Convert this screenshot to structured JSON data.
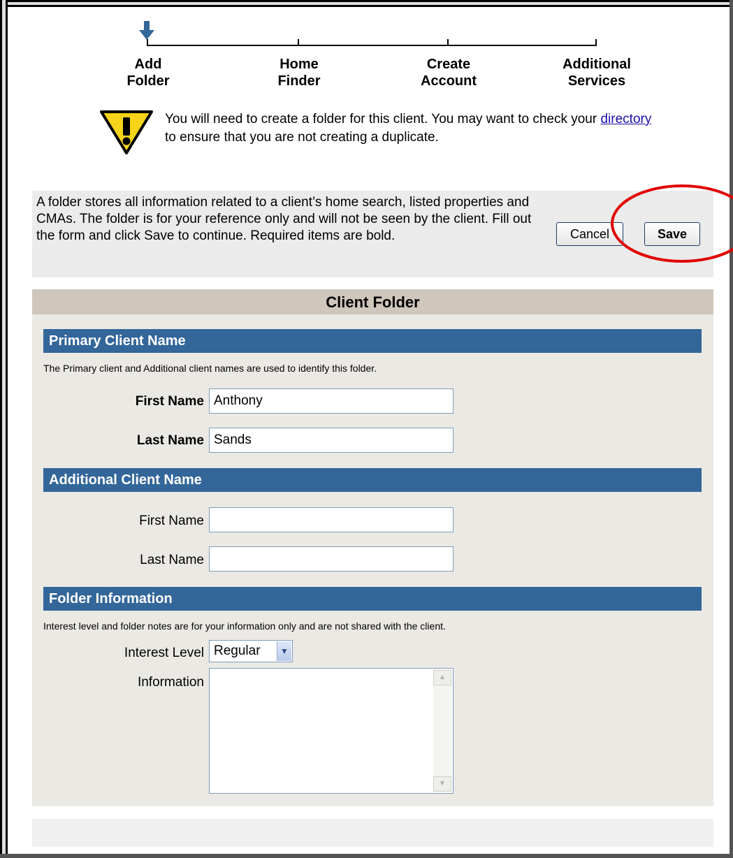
{
  "steps": [
    {
      "label": "Add\nFolder",
      "current": true
    },
    {
      "label": "Home\nFinder",
      "current": false
    },
    {
      "label": "Create\nAccount",
      "current": false
    },
    {
      "label": "Additional\nServices",
      "current": false
    }
  ],
  "warning": {
    "text_before": "You will need to create a folder for this client. You may want to check your ",
    "link": "directory",
    "text_after": " to ensure that you are not creating a duplicate."
  },
  "info": {
    "text": "A folder stores all information related to a client’s home search, listed properties and CMAs. The folder is for your reference only and will not be seen by the client. Fill out the form and click Save to continue. Required items are bold."
  },
  "buttons": {
    "cancel": "Cancel",
    "save": "Save"
  },
  "panel": {
    "title": "Client Folder"
  },
  "primary": {
    "header": "Primary Client Name",
    "note": "The Primary client and Additional client names are used to identify this folder.",
    "first_label": "First Name",
    "first_value": "Anthony",
    "last_label": "Last Name",
    "last_value": "Sands"
  },
  "additional": {
    "header": "Additional Client Name",
    "first_label": "First Name",
    "first_value": "",
    "last_label": "Last Name",
    "last_value": ""
  },
  "folder_info": {
    "header": "Folder Information",
    "note": "Interest level and folder notes are for your information only and are not shared with the client.",
    "interest_label": "Interest Level",
    "interest_value": "Regular",
    "information_label": "Information",
    "information_value": ""
  },
  "colors": {
    "section_header": "#336699",
    "panel_title": "#cfc6bc",
    "highlight": "#e00000"
  }
}
